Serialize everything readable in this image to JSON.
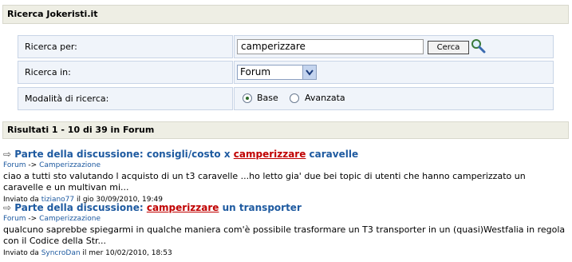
{
  "header": {
    "title": "Ricerca Jokeristi.it"
  },
  "form": {
    "search_label": "Ricerca per:",
    "search_value": "camperizzare",
    "search_button": "Cerca",
    "where_label": "Ricerca in:",
    "where_value": "Forum",
    "mode_label": "Modalità di ricerca:",
    "mode_options": [
      "Base",
      "Avanzata"
    ],
    "mode_selected": "Base"
  },
  "results_header": "Risultati 1 - 10 di 39 in Forum",
  "results": [
    {
      "prefix": "Parte della discussione: consigli/costo x ",
      "highlight": "camperizzare",
      "suffix": " caravelle",
      "crumb_a": "Forum",
      "crumb_sep": "->",
      "crumb_b": "Camperizzazione",
      "excerpt": "ciao a tutti sto valutando l acquisto di un t3 caravelle ...ho letto gia' due bei topic di utenti che hanno camperizzato un caravelle e un multivan mi...",
      "meta_pre": "Inviato da ",
      "user": "tiziano77",
      "meta_post": " il gio 30/09/2010, 19:49"
    },
    {
      "prefix": "Parte della discussione: ",
      "highlight": "camperizzare",
      "suffix": " un transporter",
      "crumb_a": "Forum",
      "crumb_sep": "->",
      "crumb_b": "Camperizzazione",
      "excerpt": "qualcuno saprebbe spiegarmi in qualche maniera com'è possibile trasformare un T3 transporter in un (quasi)Westfalia in regola con il Codice della Str...",
      "meta_pre": "Inviato da ",
      "user": "SyncroDan",
      "meta_post": " il mer 10/02/2010, 18:53"
    }
  ]
}
